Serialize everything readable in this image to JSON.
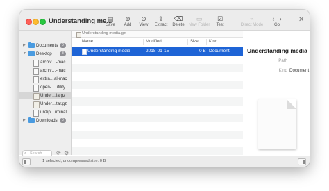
{
  "window": {
    "title": "Understanding me..."
  },
  "toolbar": {
    "items": [
      {
        "label": "Save",
        "icon": "save-icon"
      },
      {
        "label": "Add",
        "icon": "add-icon"
      },
      {
        "label": "View",
        "icon": "view-icon"
      },
      {
        "label": "Extract",
        "icon": "extract-icon"
      },
      {
        "label": "Delete",
        "icon": "delete-icon"
      },
      {
        "label": "New Folder",
        "icon": "new-folder-icon"
      },
      {
        "label": "Test",
        "icon": "test-icon"
      },
      {
        "label": "Direct Mode",
        "icon": "direct-mode-icon"
      },
      {
        "label": "Go",
        "icon": "go-icon"
      }
    ]
  },
  "sidebar": {
    "items": [
      {
        "label": "Documents",
        "badge": "0"
      },
      {
        "label": "Desktop",
        "badge": "8"
      },
      {
        "label": "archiv…-mac"
      },
      {
        "label": "archiv…-mac"
      },
      {
        "label": "extra…al-mac"
      },
      {
        "label": "open-…utility"
      },
      {
        "label": "Under…ia.gz"
      },
      {
        "label": "Under…tar.gz"
      },
      {
        "label": "unzip…rminal"
      },
      {
        "label": "Downloads",
        "badge": "0"
      }
    ],
    "search_placeholder": "Search"
  },
  "pathbar": {
    "text": "Understanding media.gz"
  },
  "filelist": {
    "columns": [
      "Name",
      "Modified",
      "Size",
      "Kind"
    ],
    "rows": [
      {
        "name": "Understanding media",
        "modified": "2018-01-15",
        "size": "0 B",
        "kind": "Document"
      }
    ]
  },
  "preview": {
    "name": "Understanding media",
    "path_label": "Path",
    "kind_label": "Kind",
    "kind_value": "Document"
  },
  "status": {
    "text": "1 selected, uncompressed size: 0 B"
  }
}
